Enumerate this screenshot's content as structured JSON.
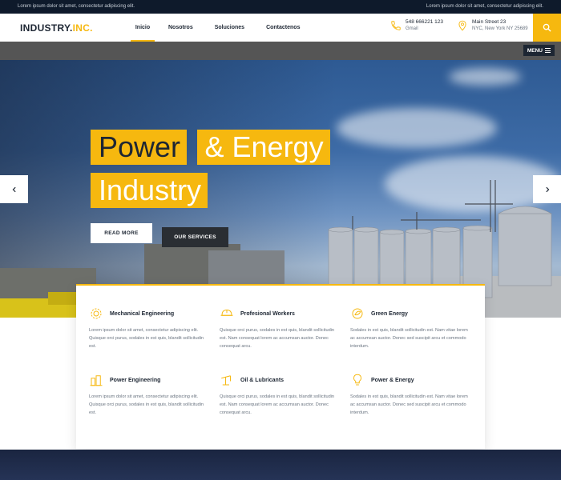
{
  "topbar": {
    "left_text": "Lorem ipsum dolor sit amet, consectetur adipiscing elit.",
    "right_text": "Lorem ipsum dolor sit amet, consectetur adipiscing elit."
  },
  "header": {
    "logo_main": "INDUSTRY.",
    "logo_accent": "INC.",
    "nav": [
      {
        "label": "Inicio",
        "active": true
      },
      {
        "label": "Nosotros",
        "active": false
      },
      {
        "label": "Soluciones",
        "active": false
      },
      {
        "label": "Contactenos",
        "active": false
      }
    ],
    "phone": {
      "line1": "548 666221 123",
      "line2": "Gmail"
    },
    "location": {
      "line1": "Main Street 23",
      "line2": "NYC, New York NY 25689"
    },
    "accent_color": "#f6b80f"
  },
  "menu_label": "MENU",
  "hero": {
    "title_line1_a": "Power",
    "title_line1_b": "& Energy",
    "title_line2": "Industry",
    "btn_read": "READ MORE",
    "btn_services": "OUR SERVICES"
  },
  "services": [
    {
      "icon": "gear-icon",
      "name": "Mechanical Engineering",
      "desc": "Lorem ipsum dolor sit amet, consectetur adipiscing elit. Quisque orci purus, sodales in est quis, blandit sollicitudin est."
    },
    {
      "icon": "worker-helmet-icon",
      "name": "Profesional Workers",
      "desc": "Quisque orci purus, sodales in est quis, blandit sollicitudin est. Nam consequat lorem ac accumsan auctor. Donec consequat arcu."
    },
    {
      "icon": "leaf-globe-icon",
      "name": "Green Energy",
      "desc": "Sodales in est quis, blandit sollicitudin est. Nam vitae lorem ac accumsan auctor. Donec sed suscipit arcu et commodo interdum."
    },
    {
      "icon": "power-plant-icon",
      "name": "Power Engineering",
      "desc": "Lorem ipsum dolor sit amet, consectetur adipiscing elit. Quisque orci purus, sodales in est quis, blandit sollicitudin est."
    },
    {
      "icon": "oil-pump-icon",
      "name": "Oil & Lubricants",
      "desc": "Quisque orci purus, sodales in est quis, blandit sollicitudin est. Nam consequat lorem ac accumsan auctor. Donec consequat arcu."
    },
    {
      "icon": "lightbulb-icon",
      "name": "Power & Energy",
      "desc": "Sodales in est quis, blandit sollicitudin est. Nam vitae lorem ac accumsan auctor. Donec sed suscipit arcu et commodo interdum."
    }
  ]
}
